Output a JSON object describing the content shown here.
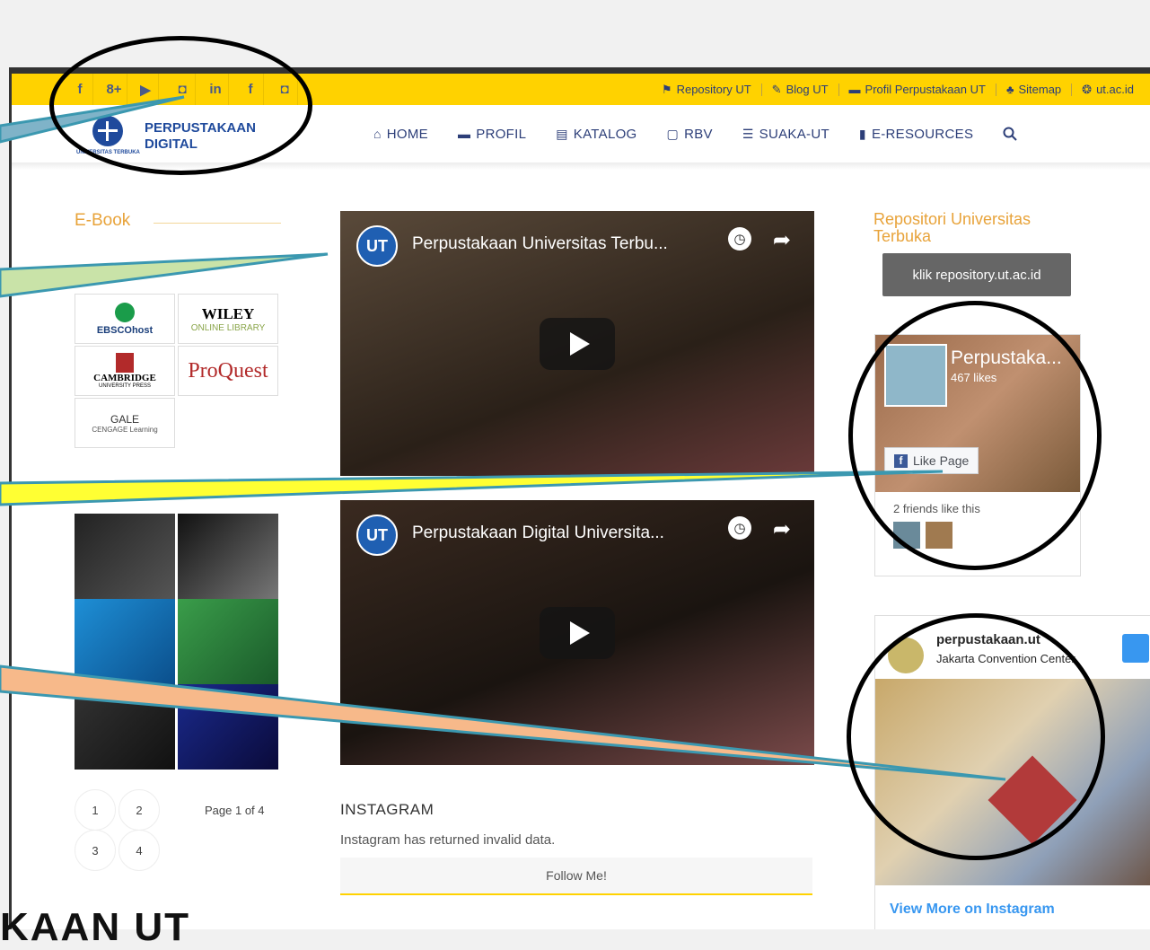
{
  "topbar": {
    "social_icons": [
      "facebook-icon",
      "googleplus-icon",
      "youtube-icon",
      "instagram-icon",
      "linkedin-icon",
      "facebook-icon",
      "instagram-icon"
    ],
    "social_glyphs": [
      "f",
      "8+",
      "▶",
      "◘",
      "in",
      "f",
      "◘"
    ],
    "links": [
      {
        "icon": "⚑",
        "label": "Repository UT"
      },
      {
        "icon": "✎",
        "label": "Blog UT"
      },
      {
        "icon": "▬",
        "label": "Profil Perpustakaan UT"
      },
      {
        "icon": "♣",
        "label": "Sitemap"
      },
      {
        "icon": "❂",
        "label": "ut.ac.id"
      }
    ]
  },
  "logo": {
    "line1": "PERPUSTAKAAN",
    "line2": "DIGITAL",
    "univ": "UNIVERSITAS TERBUKA"
  },
  "menu": [
    {
      "icon": "⌂",
      "label": "HOME"
    },
    {
      "icon": "▬",
      "label": "PROFIL"
    },
    {
      "icon": "▤",
      "label": "KATALOG"
    },
    {
      "icon": "▢",
      "label": "RBV"
    },
    {
      "icon": "☰",
      "label": "SUAKA-UT"
    },
    {
      "icon": "▮",
      "label": "E-RESOURCES"
    }
  ],
  "ebook": {
    "heading": "E-Book",
    "resources": [
      {
        "name": "EBSCOhost"
      },
      {
        "name": "WILEY",
        "sub": "ONLINE LIBRARY"
      },
      {
        "name": "CAMBRIDGE",
        "sub": "UNIVERSITY PRESS"
      },
      {
        "name": "ProQuest"
      },
      {
        "name": "GALE",
        "sub": "CENGAGE Learning"
      }
    ]
  },
  "pagination": {
    "pages": [
      "1",
      "2",
      "3",
      "4"
    ],
    "label": "Page 1 of 4"
  },
  "videos": [
    {
      "title": "Perpustakaan Universitas Terbu...",
      "channel": "UT"
    },
    {
      "title": "Perpustakaan Digital Universita...",
      "channel": "UT"
    }
  ],
  "instagram": {
    "heading": "INSTAGRAM",
    "message": "Instagram has returned invalid data.",
    "follow_label": "Follow Me!",
    "account": "perpustakaan.ut",
    "location": "Jakarta Convention Center",
    "view_more": "View More on Instagram"
  },
  "repository": {
    "heading_line1": "Repositori Universitas",
    "heading_line2": "Terbuka",
    "button": "klik repository.ut.ac.id"
  },
  "facebook": {
    "page_name": "Perpustaka...",
    "likes": "467 likes",
    "like_button": "Like Page",
    "friends": "2 friends like this"
  },
  "footer_text": "KAAN UT",
  "colors": {
    "topbar": "#ffd200",
    "accent": "#e8a33a",
    "nav": "#2c3e78",
    "highlight_callouts": [
      "#7fb3c8",
      "#c9e3a8",
      "#ffff33",
      "#f7b98a"
    ]
  }
}
